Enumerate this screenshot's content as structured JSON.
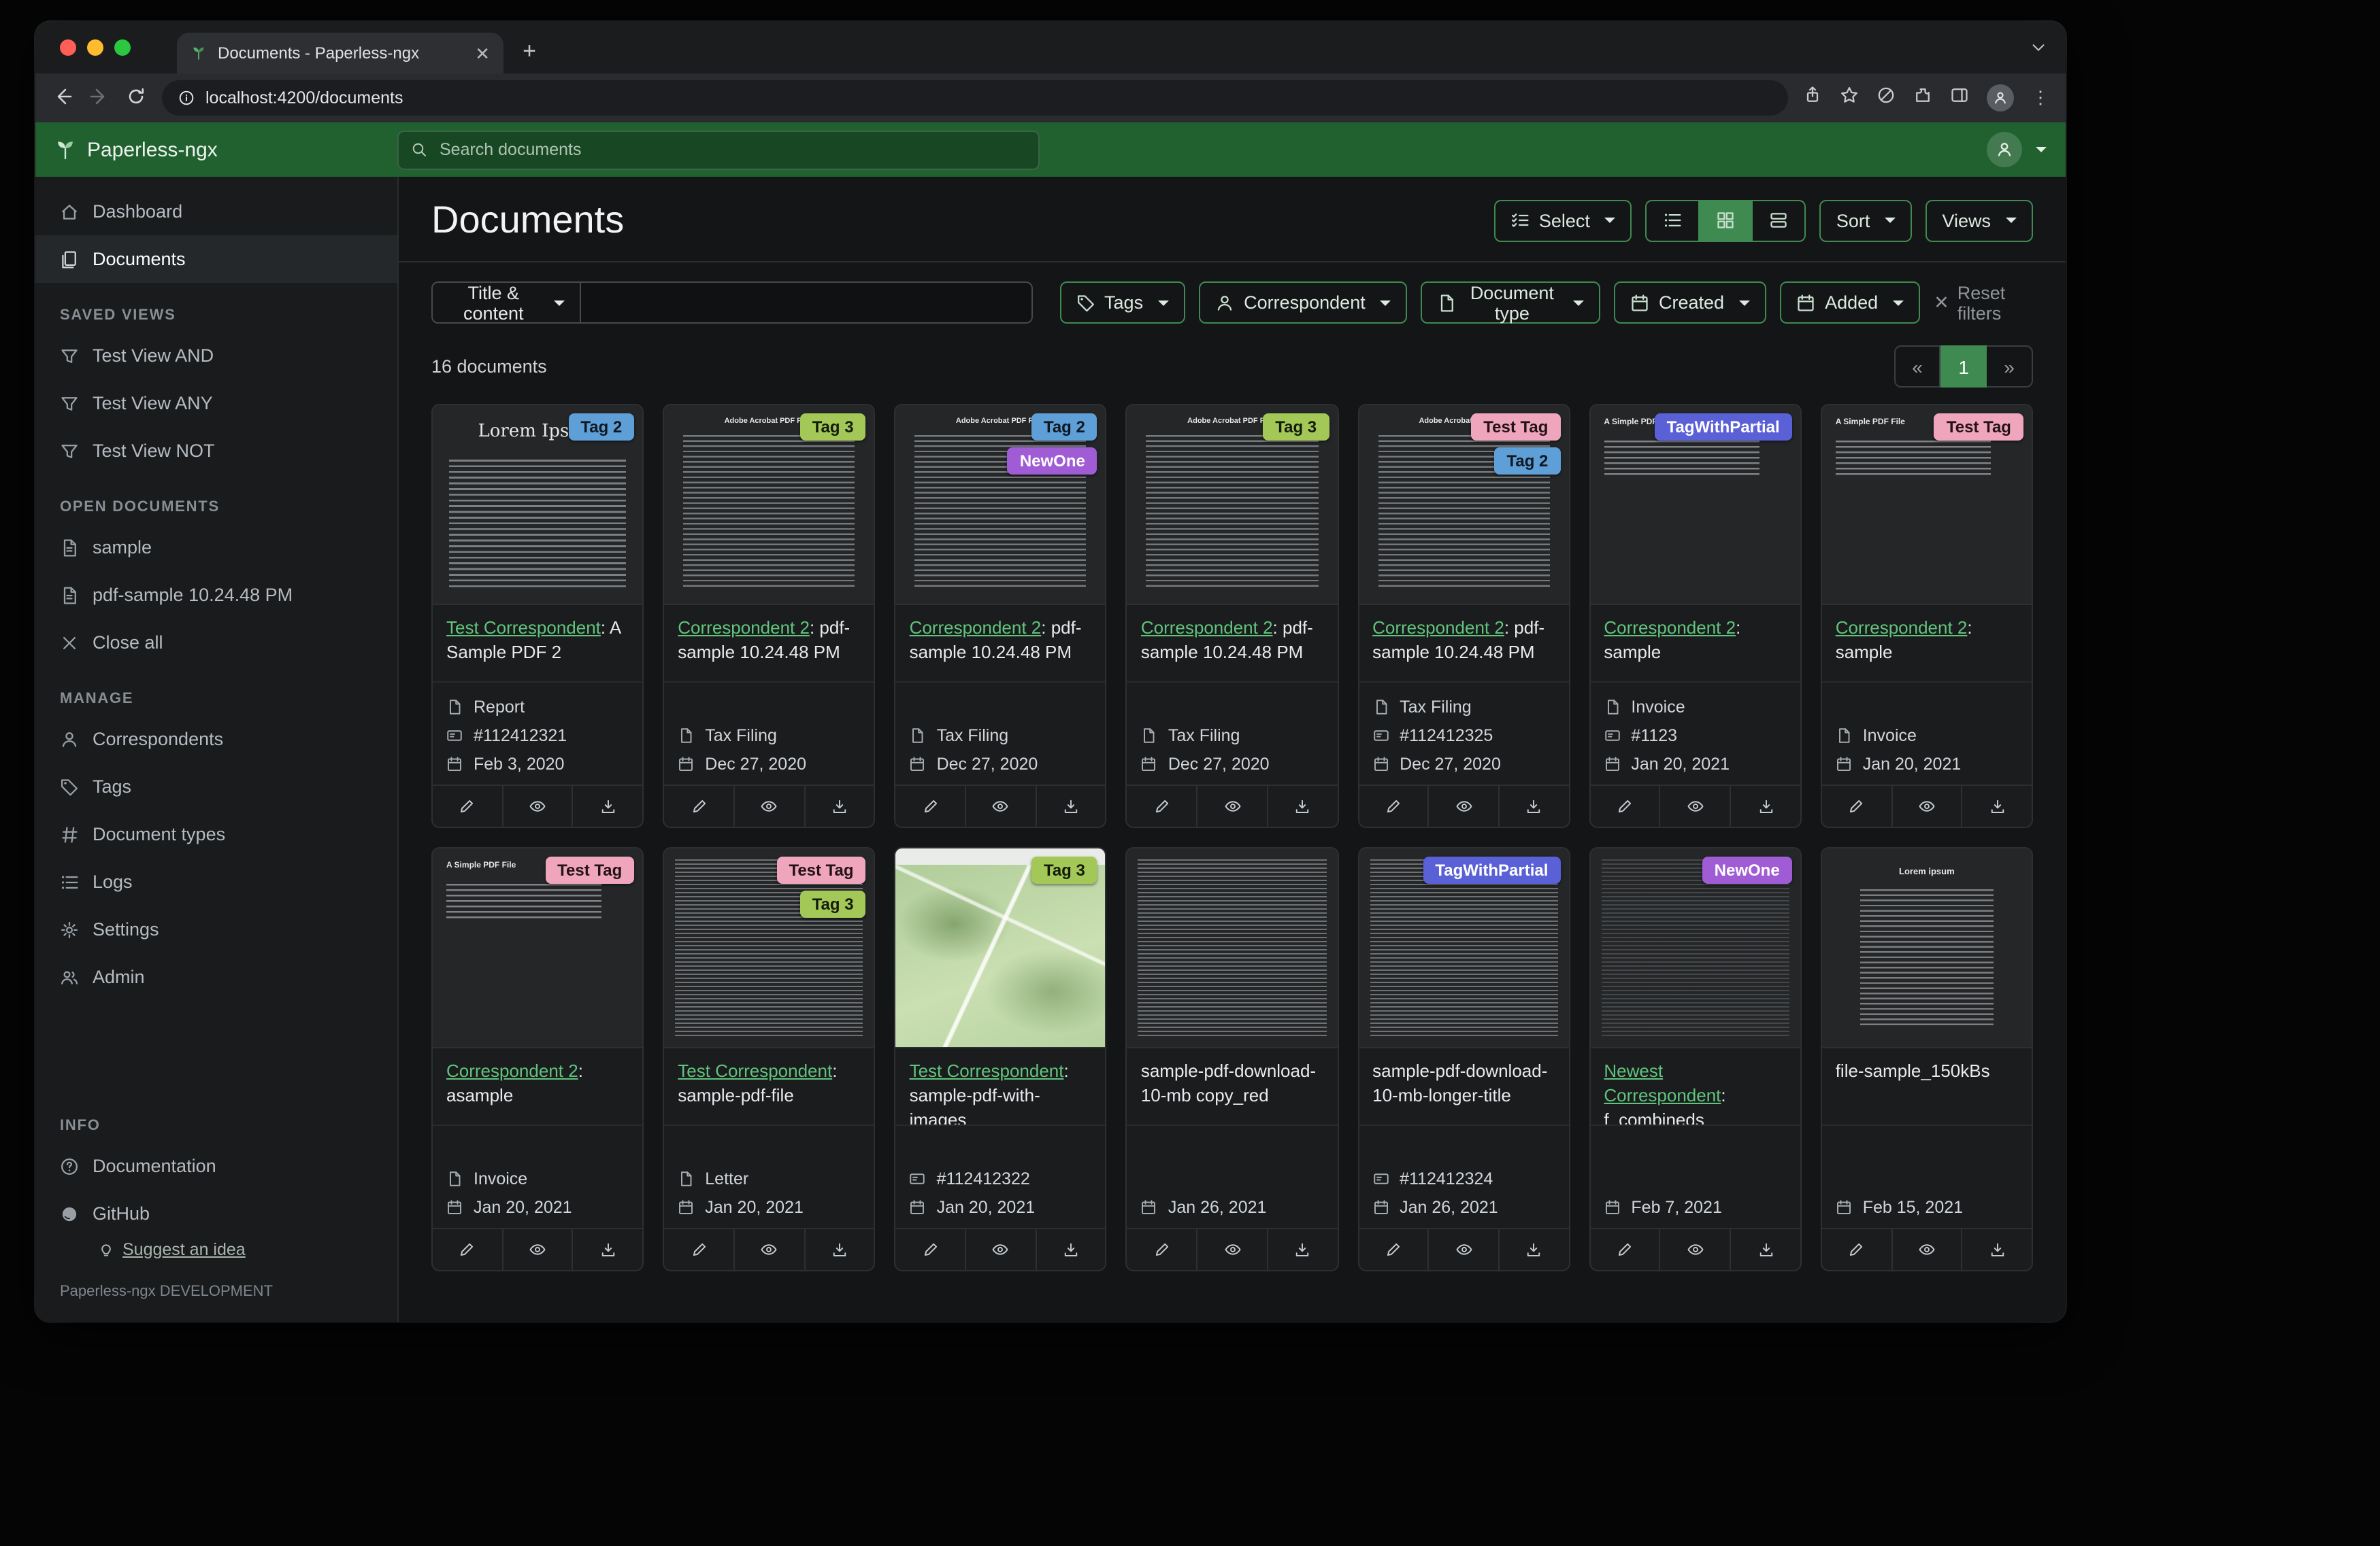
{
  "window": {
    "tab_title": "Documents - Paperless-ngx",
    "url": "localhost:4200/documents"
  },
  "app": {
    "brand": "Paperless-ngx",
    "search_placeholder": "Search documents"
  },
  "colors": {
    "accent_green": "#3f8a50",
    "link_green": "#61c47c",
    "header_green": "#20612f"
  },
  "sidebar": {
    "dashboard": "Dashboard",
    "documents": "Documents",
    "saved_views_heading": "SAVED VIEWS",
    "saved_views": [
      "Test View AND",
      "Test View ANY",
      "Test View NOT"
    ],
    "open_documents_heading": "OPEN DOCUMENTS",
    "open_documents": [
      "sample",
      "pdf-sample 10.24.48 PM"
    ],
    "close_all": "Close all",
    "manage_heading": "MANAGE",
    "manage": [
      "Correspondents",
      "Tags",
      "Document types",
      "Logs",
      "Settings",
      "Admin"
    ],
    "info_heading": "INFO",
    "documentation": "Documentation",
    "github": "GitHub",
    "suggest_idea": "Suggest an idea",
    "footer": "Paperless-ngx DEVELOPMENT"
  },
  "page": {
    "title": "Documents",
    "select_label": "Select",
    "sort_label": "Sort",
    "views_label": "Views"
  },
  "filters": {
    "field_selector": "Title & content",
    "search_value": "",
    "tags": "Tags",
    "correspondent": "Correspondent",
    "document_type": "Document type",
    "created": "Created",
    "added": "Added",
    "reset": "Reset filters"
  },
  "results": {
    "count": "16 documents"
  },
  "pagination": {
    "prev": "«",
    "page": "1",
    "next": "»"
  },
  "documents": [
    {
      "correspondent": "Test Correspondent",
      "title": ": A Sample PDF 2",
      "tags": [
        {
          "label": "Tag 2",
          "bg": "#5e9fd8",
          "fg": "#101820"
        }
      ],
      "thumb": {
        "type": "lorem",
        "heading": "Lorem Ipsum"
      },
      "fields": {
        "doctype": "Report",
        "asn": "#112412321",
        "date": "Feb 3, 2020"
      }
    },
    {
      "correspondent": "Correspondent 2",
      "title": ": pdf-sample 10.24.48 PM",
      "tags": [
        {
          "label": "Tag 3",
          "bg": "#a3c857",
          "fg": "#151c0b"
        }
      ],
      "thumb": {
        "type": "acrobat",
        "heading": "Adobe Acrobat PDF Files"
      },
      "fields": {
        "doctype": "Tax Filing",
        "date": "Dec 27, 2020"
      }
    },
    {
      "correspondent": "Correspondent 2",
      "title": ": pdf-sample 10.24.48 PM",
      "tags": [
        {
          "label": "Tag 2",
          "bg": "#5e9fd8",
          "fg": "#101820"
        },
        {
          "label": "NewOne",
          "bg": "#a05cd5",
          "fg": "#ffffff"
        }
      ],
      "thumb": {
        "type": "acrobat",
        "heading": "Adobe Acrobat PDF Files"
      },
      "fields": {
        "doctype": "Tax Filing",
        "date": "Dec 27, 2020"
      }
    },
    {
      "correspondent": "Correspondent 2",
      "title": ": pdf-sample 10.24.48 PM",
      "tags": [
        {
          "label": "Tag 3",
          "bg": "#a3c857",
          "fg": "#151c0b"
        }
      ],
      "thumb": {
        "type": "acrobat",
        "heading": "Adobe Acrobat PDF Files"
      },
      "fields": {
        "doctype": "Tax Filing",
        "date": "Dec 27, 2020"
      }
    },
    {
      "correspondent": "Correspondent 2",
      "title": ": pdf-sample 10.24.48 PM",
      "tags": [
        {
          "label": "Test Tag",
          "bg": "#efa6bc",
          "fg": "#231318"
        },
        {
          "label": "Tag 2",
          "bg": "#5e9fd8",
          "fg": "#101820"
        }
      ],
      "thumb": {
        "type": "acrobat",
        "heading": "Adobe Acrobat PDF Files"
      },
      "fields": {
        "doctype": "Tax Filing",
        "asn": "#112412325",
        "date": "Dec 27, 2020"
      }
    },
    {
      "correspondent": "Correspondent 2",
      "title": ": sample",
      "tags": [
        {
          "label": "TagWithPartial",
          "bg": "#5a60d6",
          "fg": "#ffffff"
        }
      ],
      "thumb": {
        "type": "simple",
        "heading": "A Simple PDF File"
      },
      "fields": {
        "doctype": "Invoice",
        "asn": "#1123",
        "date": "Jan 20, 2021"
      }
    },
    {
      "correspondent": "Correspondent 2",
      "title": ": sample",
      "tags": [
        {
          "label": "Test Tag",
          "bg": "#efa6bc",
          "fg": "#231318"
        }
      ],
      "thumb": {
        "type": "simple",
        "heading": "A Simple PDF File"
      },
      "fields": {
        "doctype": "Invoice",
        "date": "Jan 20, 2021"
      }
    },
    {
      "correspondent": "Correspondent 2",
      "title": ": asample",
      "tags": [
        {
          "label": "Test Tag",
          "bg": "#efa6bc",
          "fg": "#231318"
        }
      ],
      "thumb": {
        "type": "simple",
        "heading": "A Simple PDF File"
      },
      "fields": {
        "doctype": "Invoice",
        "date": "Jan 20, 2021"
      }
    },
    {
      "correspondent": "Test Correspondent",
      "title": ": sample-pdf-file",
      "tags": [
        {
          "label": "Test Tag",
          "bg": "#efa6bc",
          "fg": "#231318"
        },
        {
          "label": "Tag 3",
          "bg": "#a3c857",
          "fg": "#151c0b"
        }
      ],
      "thumb": {
        "type": "dense",
        "heading": ""
      },
      "fields": {
        "doctype": "Letter",
        "date": "Jan 20, 2021"
      }
    },
    {
      "correspondent": "Test Correspondent",
      "title": ": sample-pdf-with-images",
      "tags": [
        {
          "label": "Tag 3",
          "bg": "#a3c857",
          "fg": "#151c0b"
        }
      ],
      "thumb": {
        "type": "map",
        "heading": ""
      },
      "fields": {
        "asn": "#112412322",
        "date": "Jan 20, 2021"
      }
    },
    {
      "correspondent": null,
      "title": "sample-pdf-download-10-mb copy_red",
      "tags": [],
      "thumb": {
        "type": "dense",
        "heading": ""
      },
      "fields": {
        "date": "Jan 26, 2021"
      }
    },
    {
      "correspondent": null,
      "title": "sample-pdf-download-10-mb-longer-title",
      "tags": [
        {
          "label": "TagWithPartial",
          "bg": "#5a60d6",
          "fg": "#ffffff"
        }
      ],
      "thumb": {
        "type": "dense",
        "heading": ""
      },
      "fields": {
        "asn": "#112412324",
        "date": "Jan 26, 2021"
      }
    },
    {
      "correspondent": "Newest Correspondent",
      "title": ": f_combineds",
      "tags": [
        {
          "label": "NewOne",
          "bg": "#a05cd5",
          "fg": "#ffffff"
        }
      ],
      "thumb": {
        "type": "faint",
        "heading": ""
      },
      "fields": {
        "date": "Feb 7, 2021"
      }
    },
    {
      "correspondent": null,
      "title": "file-sample_150kBs",
      "tags": [],
      "thumb": {
        "type": "lorem2",
        "heading": "Lorem ipsum"
      },
      "fields": {
        "date": "Feb 15, 2021"
      }
    }
  ]
}
